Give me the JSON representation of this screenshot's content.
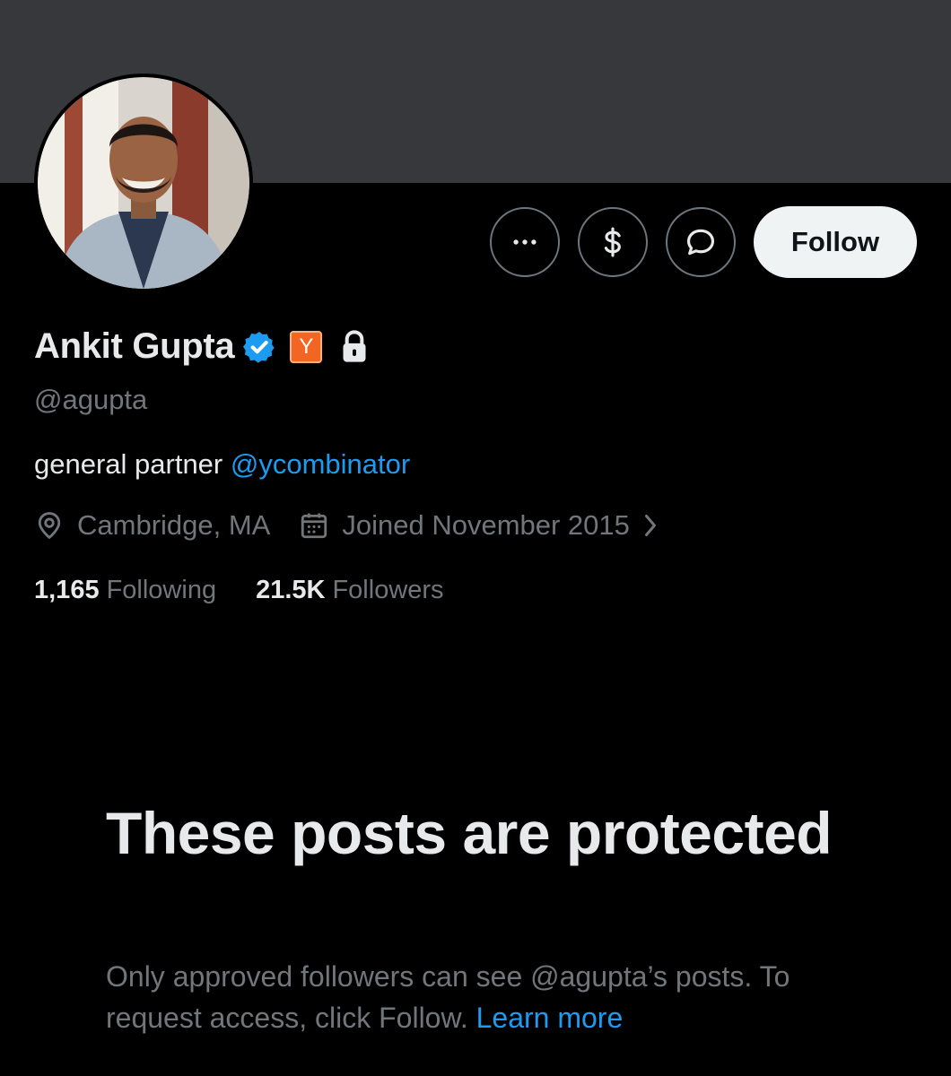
{
  "profile": {
    "display_name": "Ankit Gupta",
    "handle": "@agupta",
    "bio_text": "general partner ",
    "bio_mention": "@ycombinator",
    "location": "Cambridge, MA",
    "joined": "Joined November 2015",
    "yc_badge_letter": "Y",
    "following_count": "1,165",
    "following_label": "Following",
    "followers_count": "21.5K",
    "followers_label": "Followers"
  },
  "actions": {
    "more_icon": "more-icon",
    "tip_icon": "dollar-icon",
    "message_icon": "message-icon",
    "follow_label": "Follow"
  },
  "protected": {
    "title": "These posts are protected",
    "subtitle": "Only approved followers can see @agupta’s posts. To request access, click Follow. ",
    "learn_more": "Learn more"
  },
  "colors": {
    "background": "#000000",
    "banner": "#37383c",
    "accent": "#1d9bf0",
    "muted_text": "#71767b",
    "primary_text": "#e7e9ea",
    "yc_orange": "#f26522"
  }
}
